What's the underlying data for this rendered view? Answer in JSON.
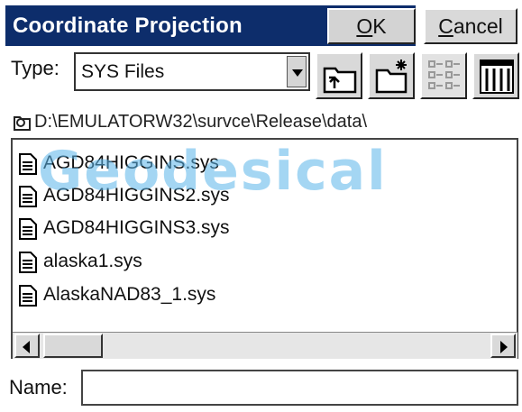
{
  "dialog": {
    "title": "Coordinate Projection",
    "ok_label": "OK",
    "ok_underline": "O",
    "ok_rest": "K",
    "cancel_label": "Cancel",
    "cancel_underline": "C",
    "cancel_rest": "ancel"
  },
  "type_row": {
    "label": "Type:",
    "selected": "SYS Files"
  },
  "toolbar": {
    "icons": [
      "up-folder-icon",
      "new-folder-icon",
      "list-view-icon",
      "details-view-icon"
    ]
  },
  "path": {
    "icon": "folder-open-icon",
    "text": "D:\\EMULATORW32\\survce\\Release\\data\\"
  },
  "watermark": "Geodesical",
  "files": [
    {
      "name": "AGD84HIGGINS.sys",
      "icon": "document-icon"
    },
    {
      "name": "AGD84HIGGINS2.sys",
      "icon": "document-icon"
    },
    {
      "name": "AGD84HIGGINS3.sys",
      "icon": "document-icon"
    },
    {
      "name": "alaska1.sys",
      "icon": "document-icon"
    },
    {
      "name": "AlaskaNAD83_1.sys",
      "icon": "document-icon"
    }
  ],
  "name_row": {
    "label": "Name:",
    "value": ""
  },
  "colors": {
    "titlebar": "#0d2d6b",
    "watermark": "#5bb6ea",
    "button_face": "#d9d9d9"
  }
}
